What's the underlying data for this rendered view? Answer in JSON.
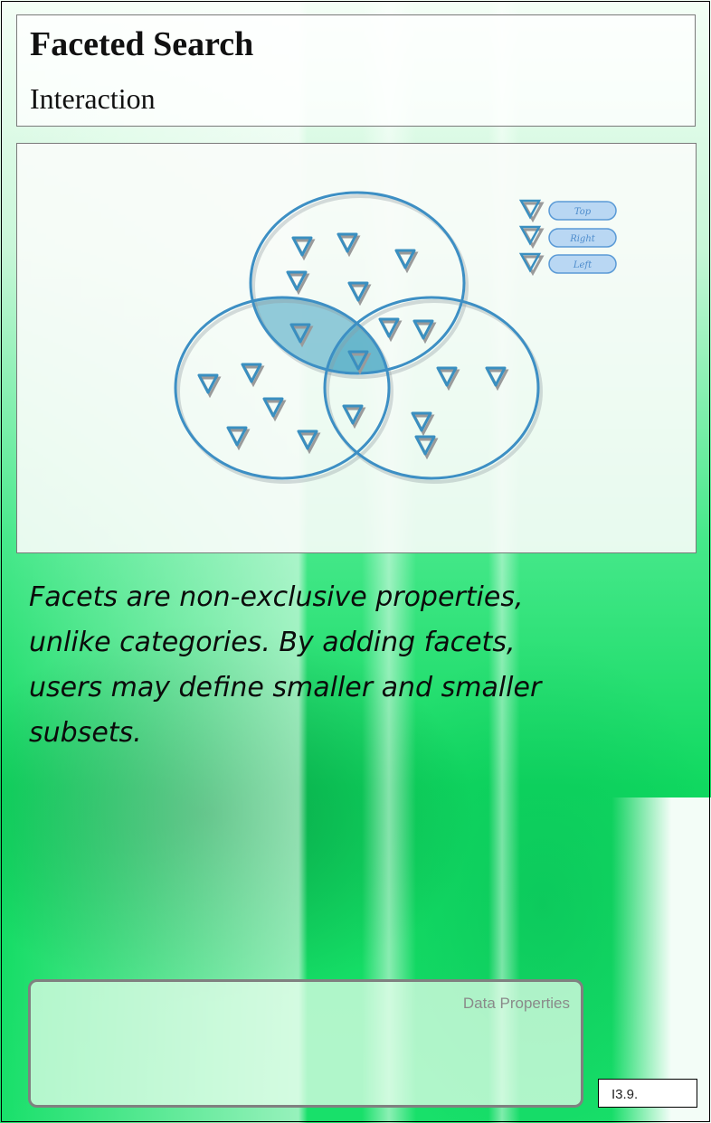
{
  "header": {
    "title": "Faceted Search",
    "subtitle": "Interaction"
  },
  "figure": {
    "legend": [
      {
        "label": "Top"
      },
      {
        "label": "Right"
      },
      {
        "label": "Left"
      }
    ],
    "colors": {
      "circle_stroke": "#3d8fc4",
      "intersection_fill": "#6fb9cf",
      "marker_stroke": "#3a8fc0",
      "marker_shadow": "#9a9a9a",
      "legend_pill_fill": "#b9d7f3"
    }
  },
  "description": "Facets are non-exclusive properties, unlike categories. By adding facets, users may define smaller and smaller subsets.",
  "footer": {
    "data_properties_label": "Data Properties",
    "code": "I3.9."
  }
}
